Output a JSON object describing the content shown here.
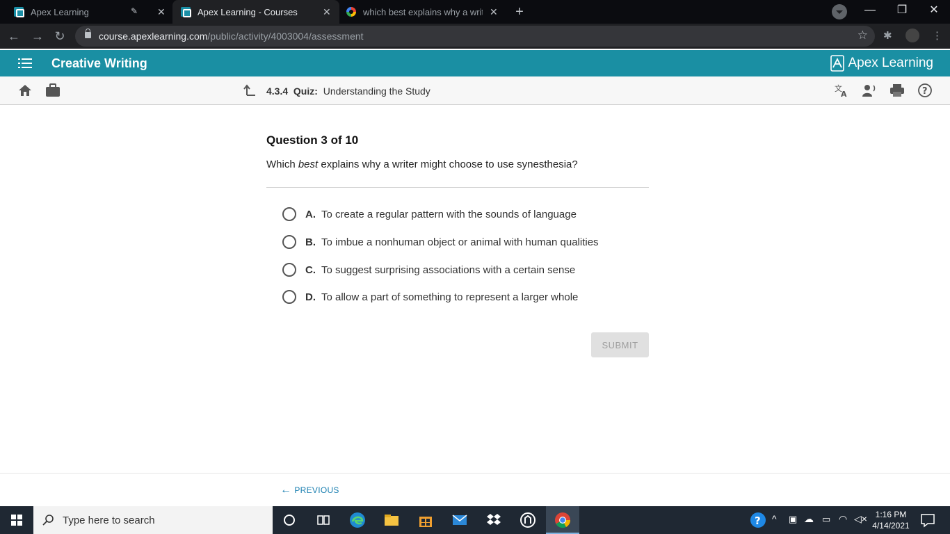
{
  "browser": {
    "tabs": [
      {
        "title": "Apex Learning",
        "icon": "apex-favicon"
      },
      {
        "title": "Apex Learning - Courses",
        "icon": "apex-favicon"
      },
      {
        "title": "which best explains why a writer",
        "icon": "google-favicon"
      }
    ],
    "url_host": "course.apexlearning.com",
    "url_path": "/public/activity/4003004/assessment"
  },
  "app": {
    "course_title": "Creative Writing",
    "brand": "Apex Learning",
    "brand_color": "#1a8fa3"
  },
  "breadcrumb": {
    "number": "4.3.4",
    "type": "Quiz:",
    "title": "Understanding the Study"
  },
  "question": {
    "counter": "Question 3 of 10",
    "text_before": "Which ",
    "text_emphasis": "best",
    "text_after": " explains why a writer might choose to use synesthesia?",
    "options": [
      {
        "letter": "A.",
        "text": "To create a regular pattern with the sounds of language"
      },
      {
        "letter": "B.",
        "text": "To imbue a nonhuman object or animal with human qualities"
      },
      {
        "letter": "C.",
        "text": "To suggest surprising associations with a certain sense"
      },
      {
        "letter": "D.",
        "text": "To allow a part of something to represent a larger whole"
      }
    ],
    "submit_label": "SUBMIT"
  },
  "footer": {
    "previous_label": "PREVIOUS"
  },
  "taskbar": {
    "search_placeholder": "Type here to search",
    "time": "1:16 PM",
    "date": "4/14/2021"
  }
}
